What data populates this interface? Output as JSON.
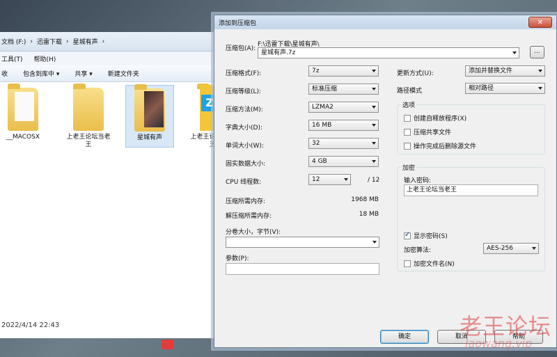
{
  "explorer": {
    "address_parts": [
      "文档 (F:)",
      "迅雷下载",
      "星城有声"
    ],
    "menu": [
      "工具(T)",
      "帮助(H)"
    ],
    "toolbar": {
      "partial": "收",
      "include": "包含到库中 ▾",
      "share": "共享 ▾",
      "new_folder": "新建文件夹"
    },
    "files": [
      {
        "name": "__MACOSX"
      },
      {
        "name": "上老王论坛当老王"
      },
      {
        "name": "星城有声"
      },
      {
        "name": "上老王论坛当老王"
      }
    ],
    "status_date": "2022/4/14 22:43"
  },
  "dialog": {
    "title": "添加到压缩包",
    "close_label": "✕",
    "archive_label": "压缩包(A):",
    "archive_path": "F:\\迅雷下载\\星城有声\\",
    "archive_name": "星城有声.7z",
    "browse_label": "...",
    "left": {
      "format_label": "压缩格式(F):",
      "format_value": "7z",
      "level_label": "压缩等级(L):",
      "level_value": "标准压缩",
      "method_label": "压缩方法(M):",
      "method_value": "LZMA2",
      "dict_label": "字典大小(D):",
      "dict_value": "16 MB",
      "word_label": "单词大小(W):",
      "word_value": "32",
      "solid_label": "固实数据大小:",
      "solid_value": "4 GB",
      "cpu_label": "CPU 线程数:",
      "cpu_value": "12",
      "cpu_total": "/ 12",
      "mem_compress_label": "压缩所需内存:",
      "mem_compress_value": "1968 MB",
      "mem_decompress_label": "解压缩所需内存:",
      "mem_decompress_value": "18 MB",
      "split_label": "分卷大小，字节(V):",
      "split_value": "",
      "params_label": "参数(P):",
      "params_value": ""
    },
    "right": {
      "update_label": "更新方式(U):",
      "update_value": "添加并替换文件",
      "path_label": "路径模式",
      "path_value": "相对路径",
      "options_title": "选项",
      "opt_sfx": "创建自释放程序(X)",
      "opt_shared": "压缩共享文件",
      "opt_delete": "操作完成后删除源文件",
      "encrypt_title": "加密",
      "password_label": "输入密码:",
      "password_value": "上老王论坛当老王",
      "show_password": "显示密码(S)",
      "enc_method_label": "加密算法:",
      "enc_method_value": "AES-256",
      "encrypt_names": "加密文件名(N)"
    },
    "buttons": {
      "ok": "确定",
      "cancel": "取消",
      "help": "帮助"
    }
  },
  "watermark": {
    "main": "老王论坛",
    "sub": "laowang.vip"
  }
}
